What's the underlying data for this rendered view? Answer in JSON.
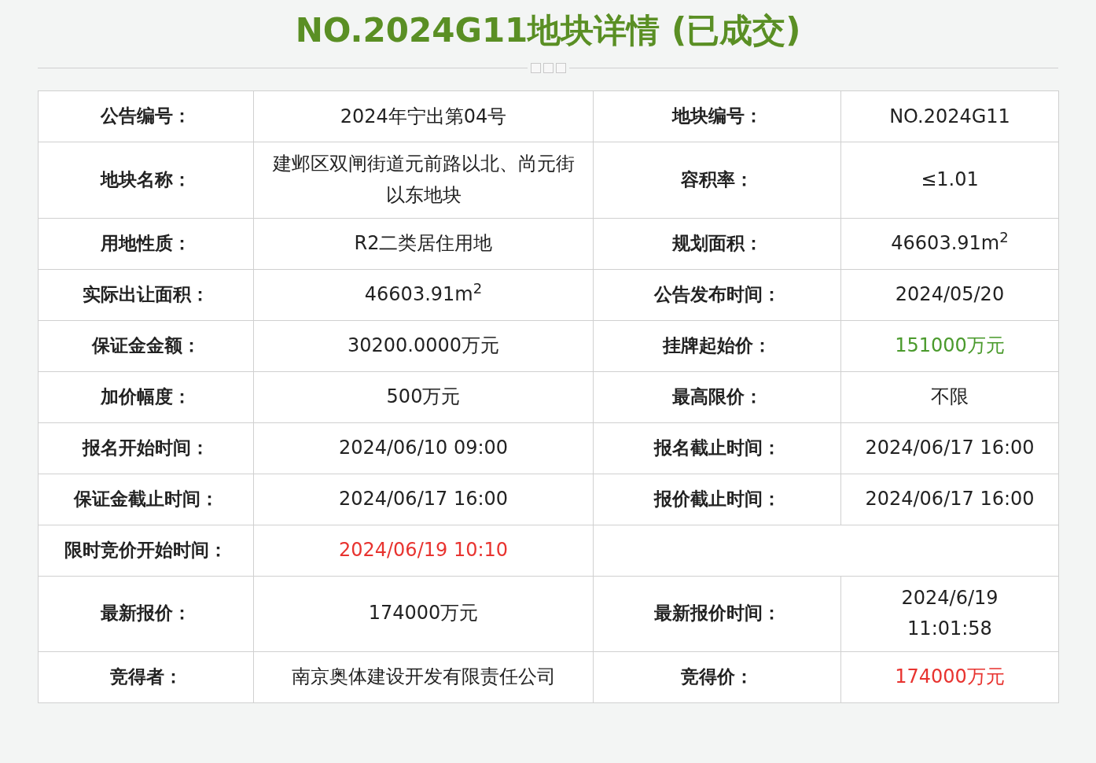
{
  "title": "NO.2024G11地块详情 (已成交)",
  "rows": [
    [
      {
        "label": "公告编号：",
        "value": "2024年宁出第04号"
      },
      {
        "label": "地块编号：",
        "value": "NO.2024G11"
      }
    ],
    [
      {
        "label": "地块名称：",
        "value": "建邺区双闸街道元前路以北、尚元街以东地块"
      },
      {
        "label": "容积率：",
        "value": "≤1.01"
      }
    ],
    [
      {
        "label": "用地性质：",
        "value": "R2二类居住用地"
      },
      {
        "label": "规划面积：",
        "value": "46603.91m$^{2}$"
      }
    ],
    [
      {
        "label": "实际出让面积：",
        "value": "46603.91m$^{2}$"
      },
      {
        "label": "公告发布时间：",
        "value": "2024/05/20"
      }
    ],
    [
      {
        "label": "保证金金额：",
        "value": "30200.0000万元"
      },
      {
        "label": "挂牌起始价：",
        "value": "151000万元",
        "color": "#4a9a2c"
      }
    ],
    [
      {
        "label": "加价幅度：",
        "value": "500万元"
      },
      {
        "label": "最高限价：",
        "value": "不限"
      }
    ],
    [
      {
        "label": "报名开始时间：",
        "value": "2024/06/10 09:00"
      },
      {
        "label": "报名截止时间：",
        "value": "2024/06/17 16:00"
      }
    ],
    [
      {
        "label": "保证金截止时间：",
        "value": "2024/06/17 16:00"
      },
      {
        "label": "报价截止时间：",
        "value": "2024/06/17 16:00"
      }
    ],
    [
      {
        "label": "限时竞价开始时间：",
        "value": "2024/06/19 10:10",
        "color": "#e8332f"
      }
    ],
    [
      {
        "label": "最新报价：",
        "value": "174000万元"
      },
      {
        "label": "最新报价时间：",
        "value": "2024/6/19\n11:01:58"
      }
    ],
    [
      {
        "label": "竞得者：",
        "value": "南京奥体建设开发有限责任公司"
      },
      {
        "label": "竞得价：",
        "value": "174000万元",
        "color": "#e8332f"
      }
    ]
  ]
}
